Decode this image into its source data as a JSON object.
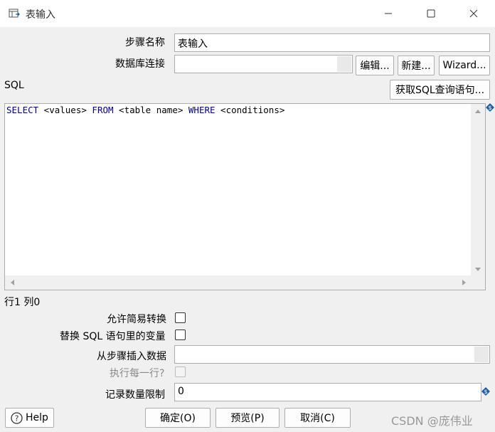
{
  "window": {
    "title": "表输入",
    "icon": "table-input-icon"
  },
  "form": {
    "step_name_label": "步骤名称",
    "step_name_value": "表输入",
    "db_conn_label": "数据库连接",
    "db_conn_value": "",
    "edit_button": "编辑...",
    "new_button": "新建...",
    "wizard_button": "Wizard...",
    "sql_label": "SQL",
    "get_sql_button": "获取SQL查询语句...",
    "sql": {
      "tokens": [
        {
          "text": "SELECT",
          "kw": true
        },
        {
          "text": " <values> ",
          "kw": false
        },
        {
          "text": "FROM",
          "kw": true
        },
        {
          "text": " <table name> ",
          "kw": false
        },
        {
          "text": "WHERE",
          "kw": true
        },
        {
          "text": " <conditions>",
          "kw": false
        }
      ]
    },
    "cursor_pos": "行1 列0",
    "lazy_conversion_label": "允许简易转换",
    "replace_vars_label": "替换 SQL 语句里的变量",
    "insert_from_step_label": "从步骤插入数据",
    "insert_from_step_value": "",
    "execute_each_row_label": "执行每一行?",
    "limit_label": "记录数量限制",
    "limit_value": "0"
  },
  "footer": {
    "help_button": "Help",
    "ok_button": "确定(O)",
    "preview_button": "预览(P)",
    "cancel_button": "取消(C)"
  },
  "watermark": "CSDN @庞伟业",
  "colors": {
    "keyword": "#00008b",
    "background": "#f0f0f0",
    "variable_icon": "#1f5fa8"
  }
}
